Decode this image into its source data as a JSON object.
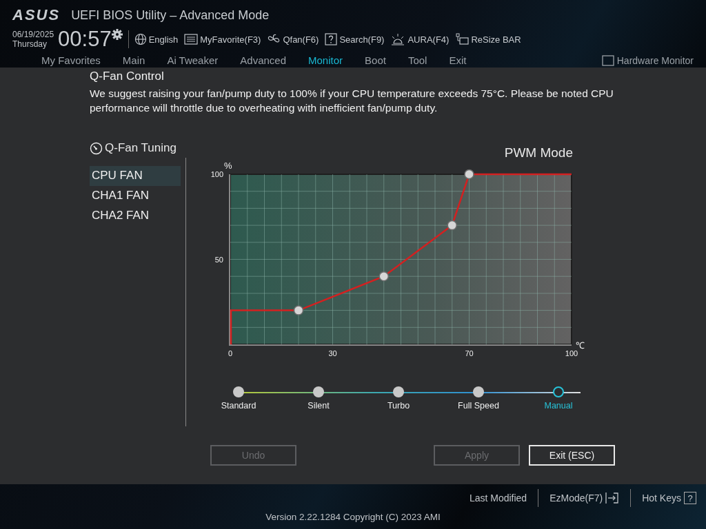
{
  "header": {
    "logo": "ASUS",
    "title": "UEFI BIOS Utility – Advanced Mode",
    "date": "06/19/2025",
    "day": "Thursday",
    "time": "00:57",
    "tools": [
      {
        "kind": "globe",
        "label": "English"
      },
      {
        "kind": "favorite",
        "label": "MyFavorite(F3)"
      },
      {
        "kind": "fan",
        "label": "Qfan(F6)"
      },
      {
        "kind": "search",
        "label": "Search(F9)"
      },
      {
        "kind": "aura",
        "label": "AURA(F4)"
      },
      {
        "kind": "resize",
        "label": "ReSize BAR"
      }
    ]
  },
  "tabs": [
    {
      "label": "My Favorites",
      "selected": false
    },
    {
      "label": "Main",
      "selected": false
    },
    {
      "label": "Ai Tweaker",
      "selected": false
    },
    {
      "label": "Advanced",
      "selected": false
    },
    {
      "label": "Monitor",
      "selected": true
    },
    {
      "label": "Boot",
      "selected": false
    },
    {
      "label": "Tool",
      "selected": false
    },
    {
      "label": "Exit",
      "selected": false
    }
  ],
  "side_panel": {
    "title": "Hardware Monitor"
  },
  "dialog": {
    "title": "Q-Fan Control",
    "description": "We suggest raising your fan/pump duty to 100% if your CPU temperature exceeds 75°C. Please be noted CPU performance will throttle due to overheating with inefficient fan/pump duty.",
    "tuning_title": "Q-Fan Tuning",
    "fans": [
      {
        "label": "CPU FAN",
        "selected": true
      },
      {
        "label": "CHA1 FAN",
        "selected": false
      },
      {
        "label": "CHA2 FAN",
        "selected": false
      }
    ],
    "mode_title": "PWM Mode",
    "chart": {
      "chart_data": {
        "type": "line",
        "ylabel": "%",
        "xlabel": "℃",
        "x": [
          0,
          0,
          20,
          45,
          65,
          70,
          100
        ],
        "series": [
          {
            "color": "#d42020",
            "values": [
              0,
              20,
              20,
              40,
              70,
              100,
              100
            ]
          }
        ],
        "xlim": [
          0,
          100
        ],
        "ylim": [
          0,
          100
        ],
        "xticks": [
          0,
          30,
          70,
          100
        ],
        "yticks": [
          50,
          100
        ],
        "grid": true
      }
    },
    "presets": [
      {
        "label": "Standard",
        "selected": false
      },
      {
        "label": "Silent",
        "selected": false
      },
      {
        "label": "Turbo",
        "selected": false
      },
      {
        "label": "Full Speed",
        "selected": false
      },
      {
        "label": "Manual",
        "selected": true
      }
    ],
    "buttons": [
      {
        "label": "Undo",
        "disabled": true
      },
      {
        "label": "Apply",
        "disabled": true
      },
      {
        "label": "Exit (ESC)",
        "disabled": false
      }
    ]
  },
  "footer": {
    "last_modified": "Last Modified",
    "ezmode": "EzMode(F7)",
    "hot_keys": "Hot Keys",
    "hot_keys_key": "?",
    "version": "Version 2.22.1284 Copyright (C) 2023 AMI"
  }
}
